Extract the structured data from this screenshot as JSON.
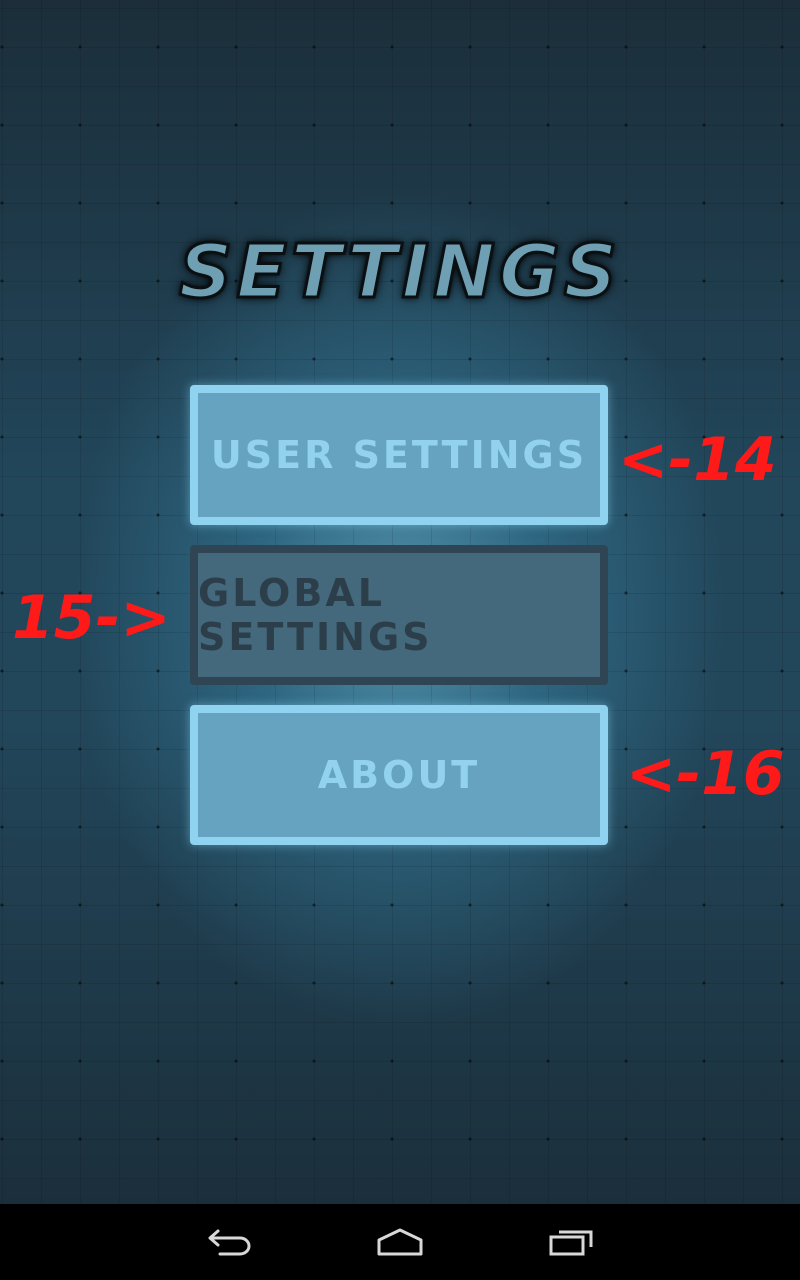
{
  "screen": {
    "title": "SETTINGS"
  },
  "menu": {
    "items": [
      {
        "label": "USER SETTINGS",
        "state": "normal"
      },
      {
        "label": "GLOBAL SETTINGS",
        "state": "pressed"
      },
      {
        "label": "ABOUT",
        "state": "normal"
      }
    ]
  },
  "annotations": {
    "user_settings": "<-14",
    "global_settings": "15->",
    "about": "<-16"
  },
  "navigation_bar": {
    "buttons": [
      {
        "icon": "back-icon"
      },
      {
        "icon": "home-icon"
      },
      {
        "icon": "recents-icon"
      }
    ]
  },
  "colors": {
    "button_light_fill": "#65a3c0",
    "button_light_border": "#8fd3f0",
    "button_dark_fill": "#44687c",
    "button_dark_border": "#2f4553",
    "annotation": "#ff1a1a",
    "nav_bar": "#000000"
  }
}
